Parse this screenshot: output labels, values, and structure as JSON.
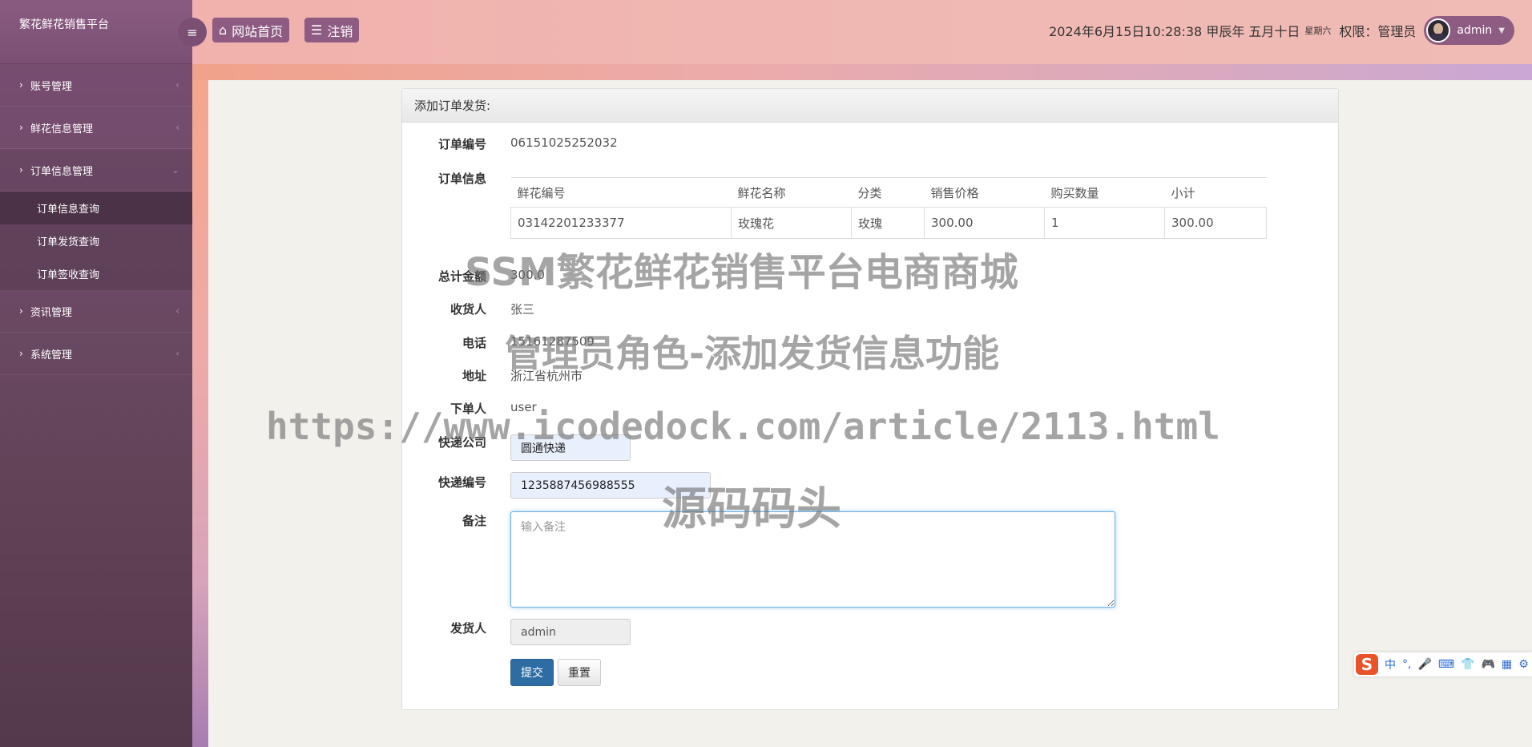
{
  "app": {
    "title": "繁花鲜花销售平台"
  },
  "header": {
    "home_label": "网站首页",
    "logout_label": "注销",
    "datetime": "2024年6月15日10:28:38 甲辰年 五月十日",
    "weekday": "星期六",
    "role_text": "权限：管理员",
    "username": "admin"
  },
  "sidebar": {
    "items": [
      {
        "label": "账号管理"
      },
      {
        "label": "鲜花信息管理"
      },
      {
        "label": "订单信息管理",
        "children": [
          {
            "label": "订单信息查询"
          },
          {
            "label": "订单发货查询"
          },
          {
            "label": "订单签收查询"
          }
        ]
      },
      {
        "label": "资讯管理"
      },
      {
        "label": "系统管理"
      }
    ]
  },
  "panel": {
    "title": "添加订单发货:",
    "order_no_label": "订单编号",
    "order_no": "06151025252032",
    "order_info_label": "订单信息",
    "table": {
      "headers": [
        "鲜花编号",
        "鲜花名称",
        "分类",
        "销售价格",
        "购买数量",
        "小计"
      ],
      "rows": [
        [
          "03142201233377",
          "玫瑰花",
          "玫瑰",
          "300.00",
          "1",
          "300.00"
        ]
      ]
    },
    "total_label": "总计金额",
    "total": "300.0",
    "receiver_label": "收货人",
    "receiver": "张三",
    "phone_label": "电话",
    "phone": "15161287509",
    "address_label": "地址",
    "address": "浙江省杭州市",
    "orderer_label": "下单人",
    "orderer": "user",
    "courier_label": "快递公司",
    "courier": "圆通快递",
    "tracking_label": "快递编号",
    "tracking": "1235887456988555",
    "remark_label": "备注",
    "remark_placeholder": "输入备注",
    "shipper_label": "发货人",
    "shipper": "admin",
    "submit_label": "提交",
    "reset_label": "重置"
  },
  "watermark": {
    "line1": "SSM繁花鲜花销售平台电商商城",
    "line2": "管理员角色-添加发货信息功能",
    "line3": "https://www.icodedock.com/article/2113.html",
    "line4": "源码码头"
  },
  "ime": {
    "lang": "中",
    "punct": "°,"
  },
  "icons": {
    "hamburger": "bars-icon",
    "home": "home-icon",
    "logout": "list-icon",
    "menu_caret": "chevron-right-icon",
    "menu_arrow": "chevron-left-icon",
    "menu_open_arrow": "chevron-down-icon",
    "user_chevron": "caret-down-icon"
  }
}
